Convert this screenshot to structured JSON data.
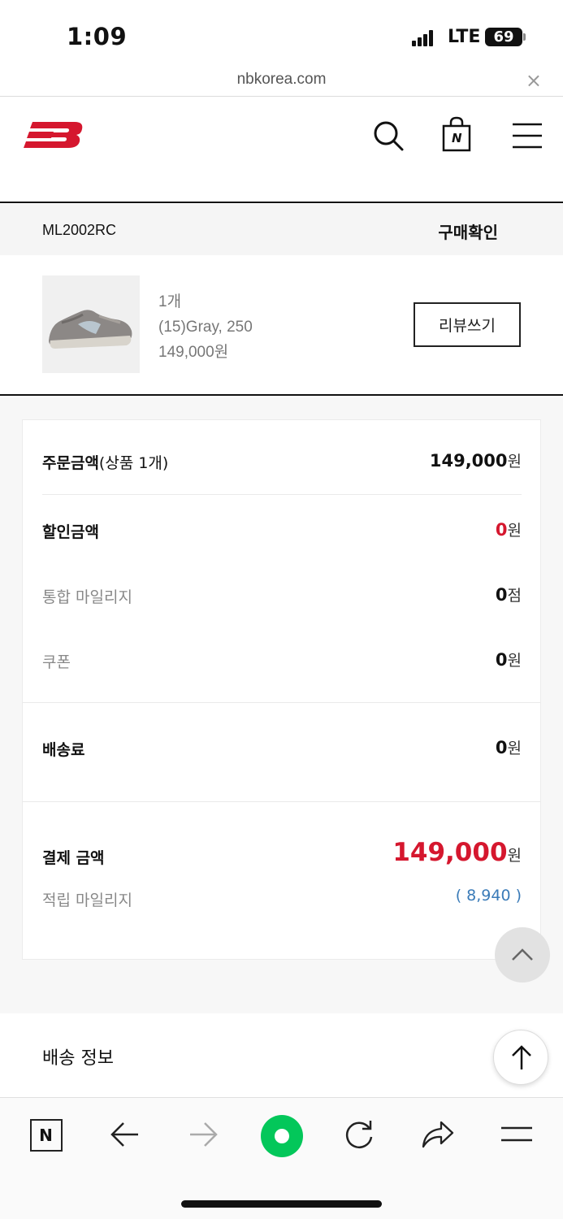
{
  "status_bar": {
    "time": "1:09",
    "network": "LTE",
    "battery": "69"
  },
  "browser": {
    "url": "nbkorea.com",
    "close_label": "×"
  },
  "site": {
    "logo_icon": "new-balance-logo",
    "icons": [
      "search-icon",
      "shopping-bag-icon",
      "menu-icon"
    ],
    "bag_letter": "N"
  },
  "order": {
    "product_code": "ML2002RC",
    "status": "구매확인",
    "item": {
      "quantity": "1개",
      "option": "(15)Gray, 250",
      "price": "149,000원",
      "review_button": "리뷰쓰기"
    }
  },
  "summary": {
    "order_amount": {
      "label": "주문금액",
      "sub": "(상품 1개)",
      "value": "149,000",
      "unit": "원"
    },
    "discount": {
      "label": "할인금액",
      "value": "0",
      "unit": "원"
    },
    "mileage": {
      "label": "통합 마일리지",
      "value": "0",
      "unit": "점"
    },
    "coupon": {
      "label": "쿠폰",
      "value": "0",
      "unit": "원"
    },
    "shipping_fee": {
      "label": "배송료",
      "value": "0",
      "unit": "원"
    },
    "payment": {
      "label": "결제 금액",
      "value": "149,000",
      "unit": "원"
    },
    "earned_mileage": {
      "label": "적립 마일리지",
      "value": "( 8,940 )"
    }
  },
  "shipping_info": {
    "title": "배송 정보"
  },
  "toolbar": {
    "items": [
      "naver-home-icon",
      "back-arrow-icon",
      "forward-arrow-icon",
      "green-dot-icon",
      "reload-icon",
      "share-icon",
      "menu-icon"
    ],
    "home_letter": "N"
  },
  "colors": {
    "accent_red": "#d5172e",
    "mileage_blue": "#3a7bb8",
    "green": "#03c75a"
  }
}
